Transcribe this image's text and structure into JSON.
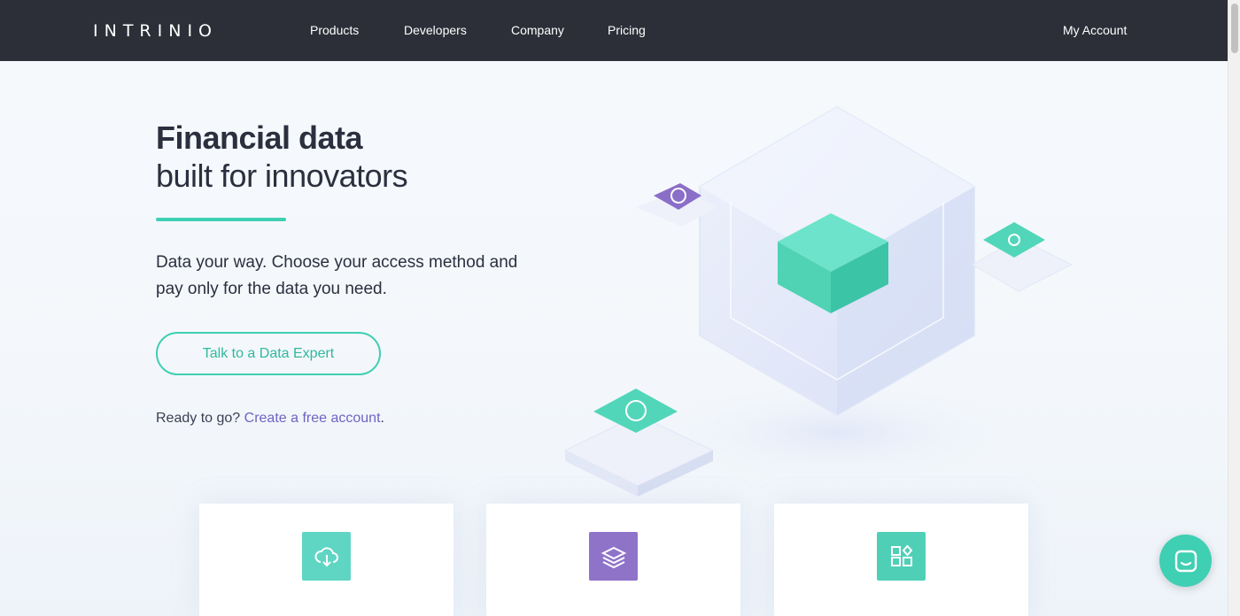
{
  "nav": {
    "logo": "INTRINIO",
    "links": [
      {
        "label": "Products"
      },
      {
        "label": "Developers"
      },
      {
        "label": "Company"
      },
      {
        "label": "Pricing"
      }
    ],
    "account": "My Account"
  },
  "hero": {
    "title": "Financial data",
    "subtitle": "built for innovators",
    "description": "Data your way. Choose your access method and pay only for the data you need.",
    "cta": "Talk to a Data Expert",
    "ready_prefix": "Ready to go?",
    "ready_link": "Create a free account",
    "ready_suffix": "."
  },
  "cards": [
    {
      "icon": "cloud-download-icon",
      "color": "#5fd6c3"
    },
    {
      "icon": "layers-icon",
      "color": "#8f73c9"
    },
    {
      "icon": "apps-grid-icon",
      "color": "#4fd0b6"
    }
  ],
  "colors": {
    "nav_bg": "#2c2f38",
    "accent": "#3fcfb3",
    "link": "#7062c4",
    "text": "#2c2f3e"
  }
}
